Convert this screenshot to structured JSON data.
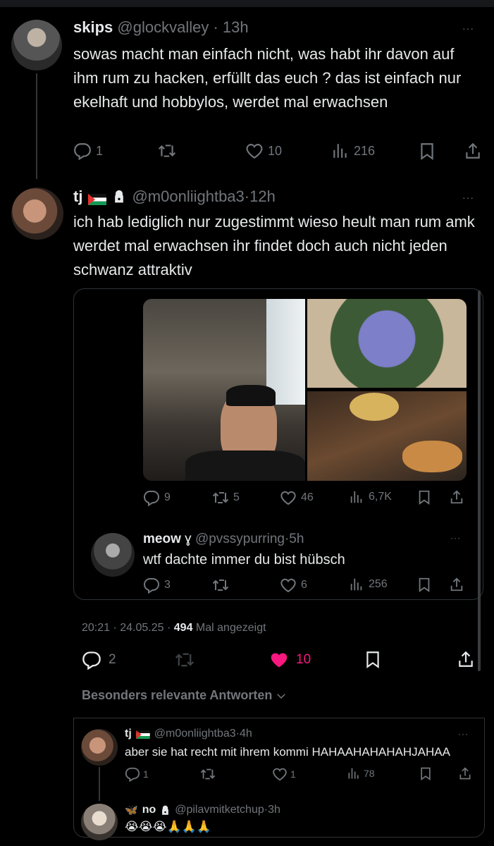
{
  "tweet1": {
    "display_name": "skips",
    "handle": "@glockvalley",
    "time": "13h",
    "text": "sowas macht man einfach nicht, was habt ihr davon auf ihm rum zu hacken, erfüllt das euch ? das ist einfach nur ekelhaft und hobbylos, werdet mal erwachsen",
    "replies": "1",
    "retweets": "",
    "likes": "10",
    "views": "216",
    "more": "···"
  },
  "tweet2": {
    "display_name": "tj",
    "handle": "@m0onliightba3",
    "time": "12h",
    "text": "ich hab lediglich nur zugestimmt wieso heult man rum amk werdet mal erwachsen ihr findet doch auch nicht jeden schwanz attraktiv",
    "more": "···",
    "quoted": {
      "replies": "9",
      "retweets": "5",
      "likes": "46",
      "views": "6,7K",
      "reply": {
        "display_name": "meow",
        "name_symbol": "ɣ",
        "handle": "@pvssypurring",
        "time": "5h",
        "text": "wtf dachte immer du bist hübsch",
        "replies": "3",
        "likes": "6",
        "views": "256",
        "more": "···"
      }
    },
    "timestamp": "20:21 · 24.05.25 ·",
    "view_count": "494",
    "view_label": "Mal angezeigt",
    "replies": "2",
    "likes": "10"
  },
  "section_label": "Besonders relevante Antworten",
  "reply1": {
    "display_name": "tj",
    "handle": "@m0onliightba3",
    "time": "4h",
    "text": "aber sie hat recht mit ihrem kommi HAHAAHAHAHAHJAHAA",
    "replies": "1",
    "likes": "1",
    "views": "78",
    "more": "···"
  },
  "reply2": {
    "display_name": "no",
    "handle": "@pilavmitketchup",
    "time": "3h",
    "text": "😭😭😭🙏🙏🙏"
  },
  "colors": {
    "background": "#000000",
    "text": "#e7e9ea",
    "muted": "#71767b",
    "like_active": "#f91880",
    "border": "#2f3336"
  },
  "icons": [
    "reply-icon",
    "retweet-icon",
    "like-icon",
    "views-icon",
    "bookmark-icon",
    "share-icon",
    "lock-icon",
    "chevron-down-icon",
    "more-icon"
  ]
}
